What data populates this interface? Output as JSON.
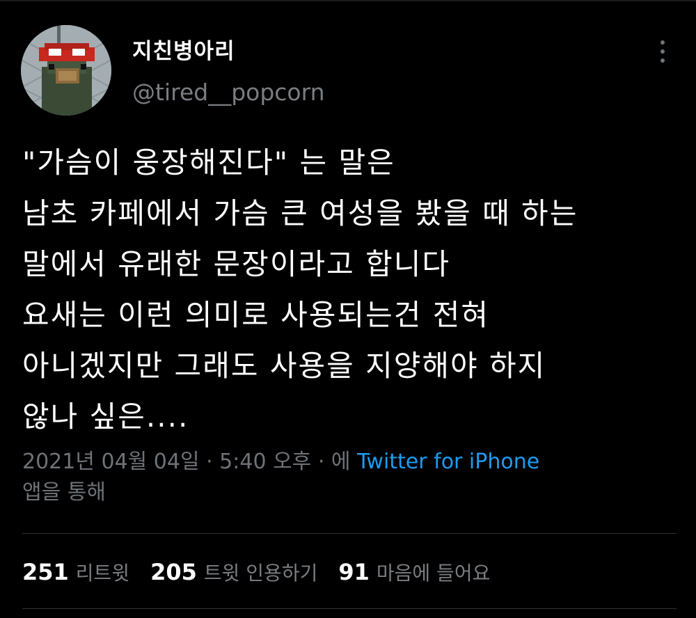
{
  "author": {
    "display_name": "지친병아리",
    "handle": "@tired__popcorn"
  },
  "tweet": {
    "lines": [
      "\"가슴이 웅장해진다\" 는 말은",
      "남초 카페에서 가슴 큰 여성을 봤을 때 하는",
      "말에서 유래한 문장이라고 합니다",
      "요새는 이런 의미로 사용되는건 전혀",
      "아니겠지만 그래도 사용을 지양해야 하지",
      "않나 싶은...."
    ]
  },
  "meta": {
    "timestamp": "2021년 04월 04일 · 5:40 오후 · 에",
    "source": "Twitter for iPhone",
    "source_suffix": "앱을 통해"
  },
  "stats": {
    "retweets_count": "251",
    "retweets_label": "리트윗",
    "quotes_count": "205",
    "quotes_label": "트윗 인용하기",
    "likes_count": "91",
    "likes_label": "마음에 들어요"
  },
  "colors": {
    "background": "#000000",
    "link": "#1d9bf0",
    "secondary_text": "#6e7378",
    "divider": "#2f3336"
  },
  "icons": {
    "more": "more-horizontal-icon"
  }
}
